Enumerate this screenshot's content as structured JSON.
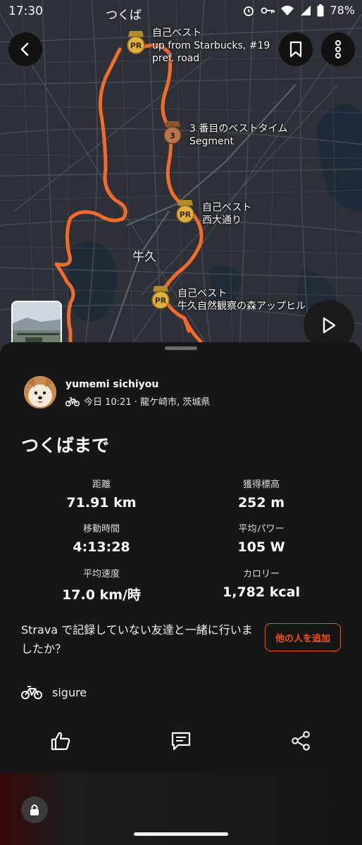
{
  "status_bar": {
    "time": "17:30",
    "map_place": "つくば",
    "battery": "78%"
  },
  "map": {
    "place_label": "牛久",
    "segments": [
      {
        "badge": "PR",
        "lines": [
          "自己ベスト",
          "up from Starbucks, #19",
          "pref. road"
        ]
      },
      {
        "badge": "3",
        "lines": [
          "3 番目のベストタイム",
          "Segment"
        ]
      },
      {
        "badge": "PR",
        "lines": [
          "自己ベスト",
          "西大通り"
        ]
      },
      {
        "badge": "PR",
        "lines": [
          "自己ベスト",
          "牛久自然観察の森アップヒル"
        ]
      }
    ]
  },
  "activity": {
    "athlete": "yumemi sichiyou",
    "meta": "今日 10:21 · 龍ケ崎市, 茨城県",
    "title": "つくばまで",
    "stats": [
      {
        "label": "距離",
        "value": "71.91 km"
      },
      {
        "label": "獲得標高",
        "value": "252 m"
      },
      {
        "label": "移動時間",
        "value": "4:13:28"
      },
      {
        "label": "平均パワー",
        "value": "105 W"
      },
      {
        "label": "平均速度",
        "value": "17.0 km/時"
      },
      {
        "label": "カロリー",
        "value": "1,782 kcal"
      }
    ],
    "prompt": "Strava で記録していない友達と一緒に行いましたか？",
    "add_button": "他の人を追加",
    "gear": "sigure"
  },
  "colors": {
    "accent": "#fc5200",
    "route": "#f26b2a",
    "map_bg": "#2c3036",
    "sheet_bg": "#161616"
  },
  "icons": [
    "back-arrow-icon",
    "bookmark-icon",
    "more-vertical-icon",
    "play-icon",
    "bike-icon",
    "kudos-thumb-icon",
    "comment-icon",
    "share-icon",
    "lock-icon"
  ]
}
